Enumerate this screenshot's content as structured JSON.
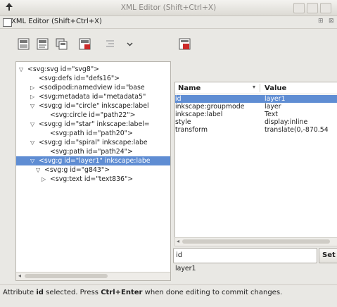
{
  "window": {
    "title": "XML Editor (Shift+Ctrl+X)"
  },
  "dock": {
    "title": "XML Editor (Shift+Ctrl+X)",
    "buttons": [
      "⊞",
      "⊠"
    ]
  },
  "toolbar": {
    "buttons": [
      {
        "icon": "new-element-node-icon"
      },
      {
        "icon": "new-text-node-icon"
      },
      {
        "icon": "duplicate-node-icon"
      },
      {
        "icon": "delete-node-icon"
      },
      {
        "icon": "unindent-node-icon"
      },
      {
        "icon": "indent-node-dropdown-icon"
      }
    ],
    "attr_buttons": [
      {
        "icon": "delete-attribute-icon"
      }
    ]
  },
  "tree": {
    "nodes": [
      {
        "arrow": "▽",
        "text": "<svg:svg id=\"svg8\">",
        "selected": false
      },
      {
        "arrow": "",
        "text": "<svg:defs id=\"defs16\">",
        "selected": false
      },
      {
        "arrow": "▷",
        "text": "<sodipodi:namedview id=\"base",
        "selected": false
      },
      {
        "arrow": "▷",
        "text": "<svg:metadata id=\"metadata5\"",
        "selected": false
      },
      {
        "arrow": "▽",
        "text": "<svg:g id=\"circle\" inkscape:label",
        "selected": false
      },
      {
        "arrow": "",
        "text": "<svg:circle id=\"path22\">",
        "selected": false
      },
      {
        "arrow": "▽",
        "text": "<svg:g id=\"star\" inkscape:label=",
        "selected": false
      },
      {
        "arrow": "",
        "text": "<svg:path id=\"path20\">",
        "selected": false
      },
      {
        "arrow": "▽",
        "text": "<svg:g id=\"spiral\" inkscape:labe",
        "selected": false
      },
      {
        "arrow": "",
        "text": "<svg:path id=\"path24\">",
        "selected": false
      },
      {
        "arrow": "▽",
        "text": "<svg:g id=\"layer1\" inkscape:labe",
        "selected": true
      },
      {
        "arrow": "▽",
        "text": "<svg:g id=\"g843\">",
        "selected": false
      },
      {
        "arrow": "▷",
        "text": "<svg:text id=\"text836\">",
        "selected": false
      }
    ]
  },
  "attributes": {
    "col_name": "Name",
    "col_value": "Value",
    "sort_icon": "chevron-down-icon",
    "rows": [
      {
        "name": "id",
        "value": "layer1",
        "selected": true
      },
      {
        "name": "inkscape:groupmode",
        "value": "layer",
        "selected": false
      },
      {
        "name": "inkscape:label",
        "value": "Text",
        "selected": false
      },
      {
        "name": "style",
        "value": "display:inline",
        "selected": false
      },
      {
        "name": "transform",
        "value": "translate(0,-870.54",
        "selected": false
      }
    ]
  },
  "editor": {
    "attr_name": "id",
    "set_label": "Set",
    "attr_value": "layer1"
  },
  "status": {
    "prefix": "Attribute ",
    "attr": "id",
    "middle": " selected. Press ",
    "shortcut": "Ctrl+Enter",
    "suffix": " when done editing to commit changes."
  },
  "colors": {
    "selection": "#5f8dd3",
    "delete_red": "#cc2a2a"
  }
}
